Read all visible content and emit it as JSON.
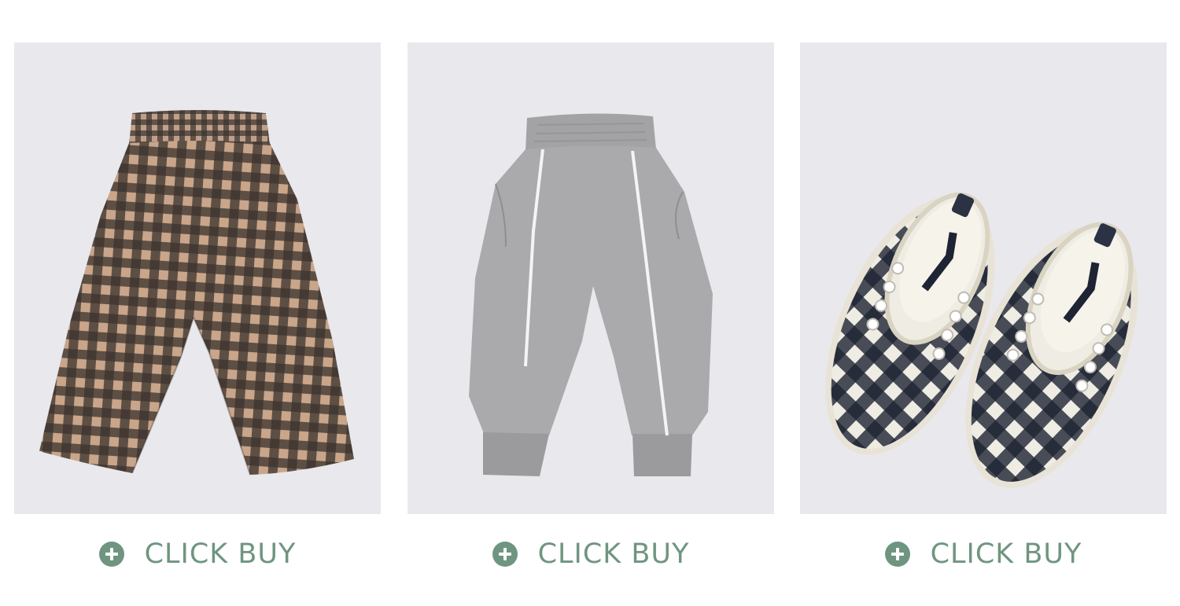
{
  "theme": {
    "accent": "#6f9580",
    "tile_background": "#e9e8ed"
  },
  "products": [
    {
      "image_icon": "plaid-pants-icon",
      "buy_label": "CLICK BUY",
      "buy_icon": "plus-circle-icon"
    },
    {
      "image_icon": "grey-joggers-icon",
      "buy_label": "CLICK BUY",
      "buy_icon": "plus-circle-icon"
    },
    {
      "image_icon": "plaid-shoes-icon",
      "buy_label": "CLICK BUY",
      "buy_icon": "plus-circle-icon"
    }
  ]
}
